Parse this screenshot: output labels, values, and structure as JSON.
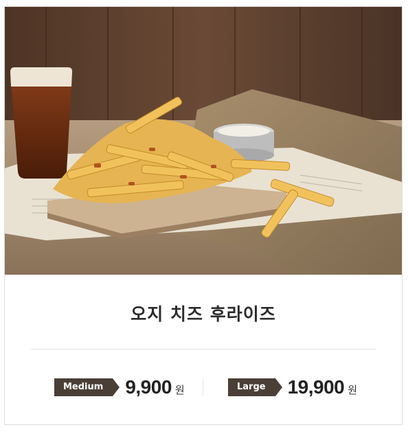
{
  "product": {
    "name": "오지 치즈 후라이즈",
    "image_alt": "cheese fries photo"
  },
  "prices": [
    {
      "size": "Medium",
      "amount": "9,900",
      "unit": "원"
    },
    {
      "size": "Large",
      "amount": "19,900",
      "unit": "원"
    }
  ],
  "colors": {
    "tag_bg": "#4a3f36",
    "title": "#2b2b2b",
    "border": "#dcdcdc"
  }
}
